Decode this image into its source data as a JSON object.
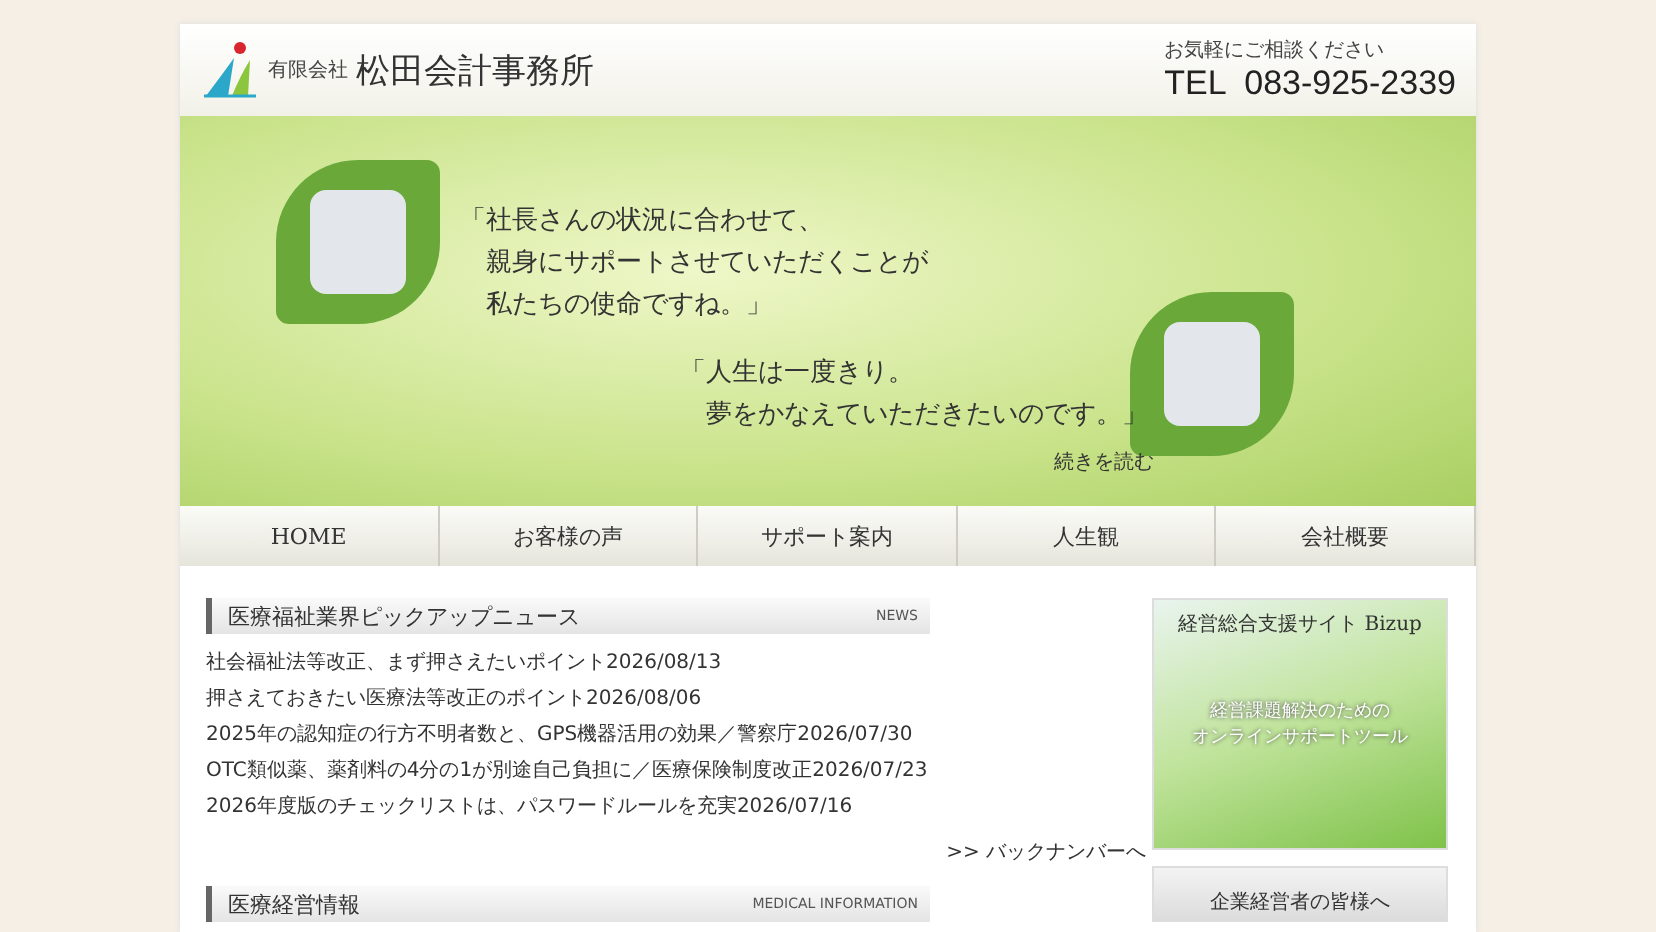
{
  "header": {
    "company_type": "有限会社",
    "company_name": "松田会計事務所",
    "contact_prompt": "お気軽にご相談ください",
    "phone": "TEL  083-925-2339"
  },
  "banner": {
    "quotes": [
      {
        "lines": [
          "「社長さんの状況に合わせて、",
          "親身にサポートさせていただくことが",
          "私たちの使命ですね。」"
        ]
      },
      {
        "lines": [
          "「人生は一度きり。",
          "夢をかなえていただきたいのです。」"
        ]
      }
    ],
    "read_more": "続きを読む"
  },
  "nav": [
    {
      "label": "HOME",
      "selected": false
    },
    {
      "label": "お客様の声",
      "selected": false
    },
    {
      "label": "サポート案内",
      "selected": false
    },
    {
      "label": "人生観",
      "selected": false
    },
    {
      "label": "会社概要",
      "selected": false
    }
  ],
  "news": {
    "title": "医療福祉業界ピックアップニュース",
    "tag": "NEWS",
    "items": [
      "社会福祉法等改正、まず押さえたいポイント2026/08/13",
      "押さえておきたい医療法等改正のポイント2026/08/06",
      "2025年の認知症の行方不明者数と、GPS機器活用の効果／警察庁2026/07/30",
      "OTC類似薬、薬剤料の4分の1が別途自己負担に／医療保険制度改正2026/07/23",
      "2026年度版のチェックリストは、パスワードルールを充実2026/07/16"
    ],
    "more": ">> バックナンバーへ"
  },
  "medical": {
    "title": "医療経営情報",
    "tag": "MEDICAL INFORMATION"
  },
  "sidebar": [
    {
      "title": "経営総合支援サイト Bizup",
      "caption": [
        "経営課題解決のための",
        "オンラインサポートツール"
      ]
    },
    {
      "title": "企業経営者の皆様へ"
    }
  ]
}
